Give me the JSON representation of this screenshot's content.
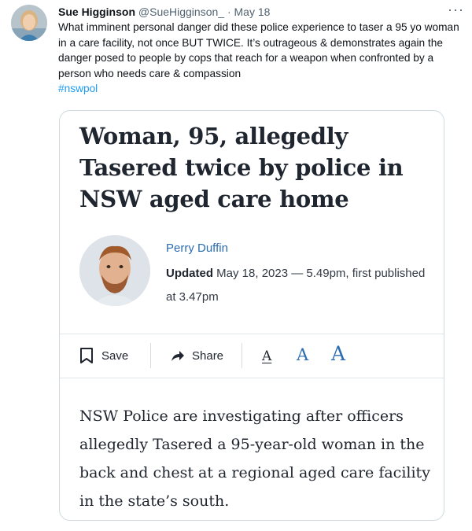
{
  "tweet": {
    "author_name": "Sue Higginson",
    "handle": "@SueHigginson_",
    "separator": "·",
    "date": "May 18",
    "more_icon": "more-horizontal-icon",
    "text": "What imminent personal danger did these police experience to taser a 95 yo woman in a care facility, not once BUT TWICE. It’s outrageous & demonstrates again the danger posed to people by cops that reach for a weapon when confronted by a person who needs care & compassion",
    "hashtag": "#nswpol"
  },
  "article": {
    "headline": "Woman, 95, allegedly Tasered twice by police in NSW aged care home",
    "reporter": "Perry Duffin",
    "updated_label": "Updated",
    "updated_text": "May 18, 2023 — 5.49pm, first published at 3.47pm",
    "save_label": "Save",
    "share_label": "Share",
    "font_size_options": [
      "A",
      "A",
      "A"
    ],
    "lede": "NSW Police are investigating after officers allegedly Tasered a 95-year-old woman in the back and chest at a regional aged care facility in the state’s south."
  },
  "colors": {
    "hashtag": "#1d9bf0",
    "reporter_link": "#2b6cb0",
    "font_size_active": "#2b6cb0"
  }
}
